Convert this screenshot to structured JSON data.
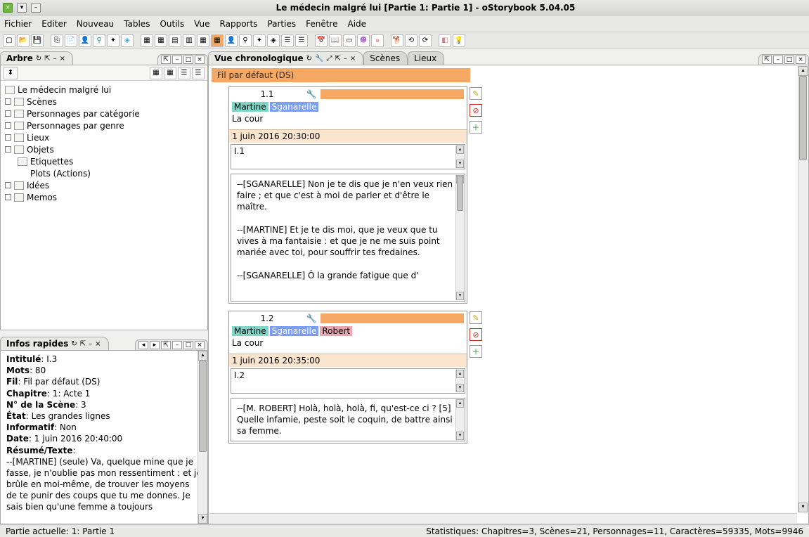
{
  "window": {
    "title": "Le médecin malgré lui [Partie 1: Partie 1] - oStorybook 5.04.05"
  },
  "menu": [
    "Fichier",
    "Editer",
    "Nouveau",
    "Tables",
    "Outils",
    "Vue",
    "Rapports",
    "Parties",
    "Fenêtre",
    "Aide"
  ],
  "panels": {
    "arbre": {
      "title": "Arbre"
    },
    "infos": {
      "title": "Infos rapides"
    },
    "chrono": {
      "title": "Vue chronologique"
    },
    "tab_scenes": "Scènes",
    "tab_lieux": "Lieux"
  },
  "tree": {
    "root": "Le médecin malgré lui",
    "nodes": [
      "Scènes",
      "Personnages par catégorie",
      "Personnages par genre",
      "Lieux",
      "Objets",
      "Etiquettes",
      "Plots (Actions)",
      "Idées",
      "Memos"
    ]
  },
  "infos": {
    "intitule_l": "Intitulé",
    "intitule_v": ": I.3",
    "mots_l": "Mots",
    "mots_v": ": 80",
    "fil_l": "Fil",
    "fil_v": ": Fil par défaut (DS)",
    "chap_l": "Chapitre",
    "chap_v": ": 1: Acte 1",
    "scnum_l": "N° de la Scène",
    "scnum_v": ": 3",
    "etat_l": "État",
    "etat_v": ": Les grandes lignes",
    "info_l": "Informatif",
    "info_v": ": Non",
    "date_l": "Date",
    "date_v": ": 1 juin 2016 20:40:00",
    "resume_l": "Résumé/Texte",
    "resume_body": "--[MARTINE] (seule) Va, quelque mine que je fasse, je n'oublie pas mon ressentiment : et je brûle en moi-même, de trouver les moyens de te punir des coups que tu me donnes. Je sais bien qu'une femme a toujours"
  },
  "chrono": {
    "strand": "Fil par défaut (DS)",
    "scenes": [
      {
        "num": "1.1",
        "chars": [
          "Martine",
          "Sganarelle"
        ],
        "loc": "La cour",
        "date": "1 juin 2016 20:30:00",
        "slug": "I.1",
        "text": "--[SGANARELLE] Non je te dis que je n'en veux rien faire ; et que c'est à moi de parler et d'être le maître.\n\n--[MARTINE] Et je te dis moi, que je veux que tu vives à ma fantaisie : et que je ne me suis point mariée avec toi, pour souffrir tes fredaines.\n\n--[SGANARELLE] Ô la grande fatigue que d'"
      },
      {
        "num": "1.2",
        "chars": [
          "Martine",
          "Sganarelle",
          "Robert"
        ],
        "loc": "La cour",
        "date": "1 juin 2016 20:35:00",
        "slug": "I.2",
        "text": "--[M. ROBERT] Holà, holà, holà, fi, qu'est-ce ci ? [5] Quelle infamie, peste soit le coquin, de battre ainsi sa femme."
      }
    ]
  },
  "status": {
    "left": "Partie actuelle: 1: Partie 1",
    "right": "Statistiques: Chapitres=3,  Scènes=21,  Personnages=11,  Caractères=59335,  Mots=9946"
  }
}
